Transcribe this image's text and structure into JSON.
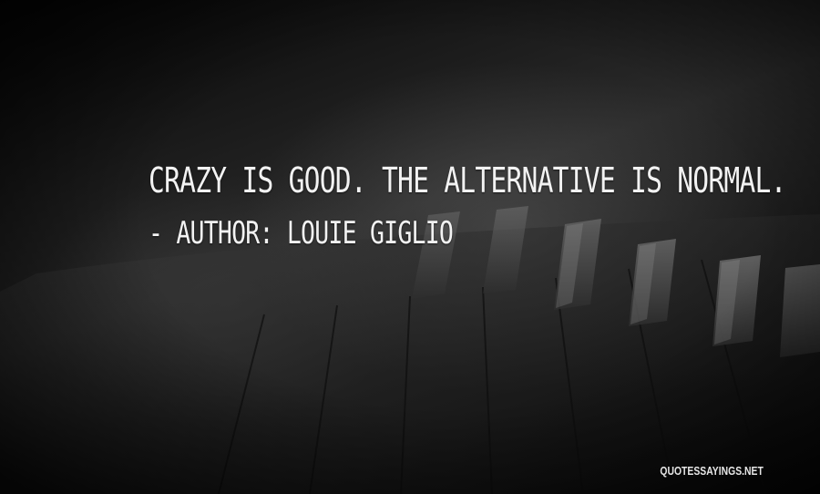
{
  "quote": {
    "text": "Crazy is good. The alternative is normal.",
    "author_line": "- Author: Louie Giglio"
  },
  "watermark": {
    "text": "QUOTESSAYINGS.NET"
  },
  "colors": {
    "text": "#f2f2f2",
    "background_dark": "#0c0c0c",
    "background_mid": "#2a2a2a"
  }
}
